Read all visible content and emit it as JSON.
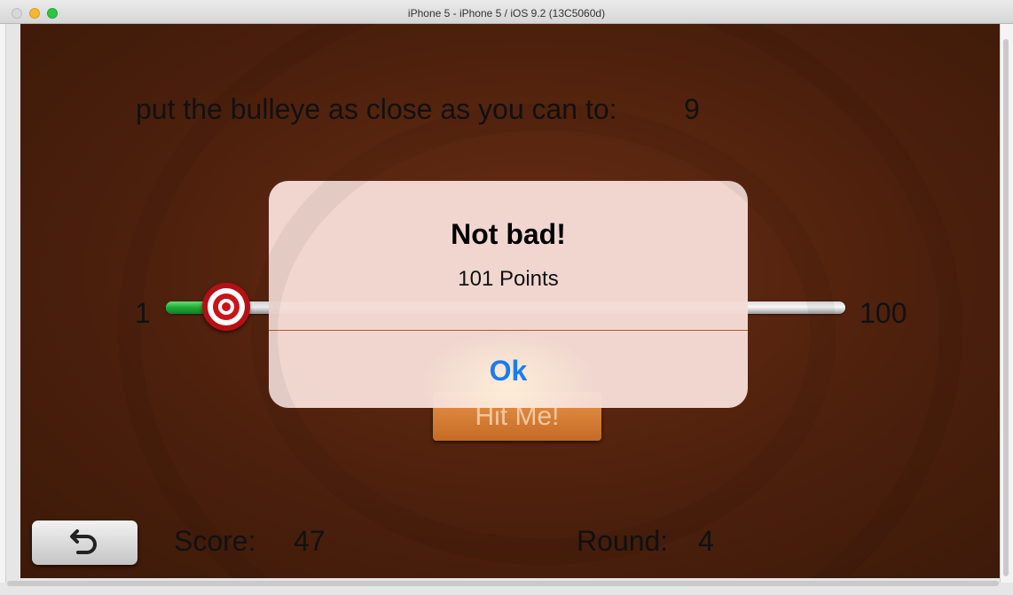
{
  "window": {
    "title": "iPhone 5 - iPhone 5 / iOS 9.2 (13C5060d)"
  },
  "game": {
    "target_prompt": "put the bulleye as close as you can to:",
    "target_value": "9",
    "slider": {
      "min_label": "1",
      "max_label": "100",
      "value_fraction": 0.03
    },
    "hit_button_label": "Hit Me!",
    "score_label": "Score:",
    "score_value": "47",
    "round_label": "Round:",
    "round_value": "4",
    "start_over_icon": "undo-arrow-icon"
  },
  "alert": {
    "title": "Not bad!",
    "message": "101 Points",
    "ok_label": "Ok"
  },
  "colors": {
    "alert_button": "#1a7cf2",
    "slider_fill": "#20a836",
    "hit_button": "#d27a33",
    "background": "#5a2610"
  }
}
